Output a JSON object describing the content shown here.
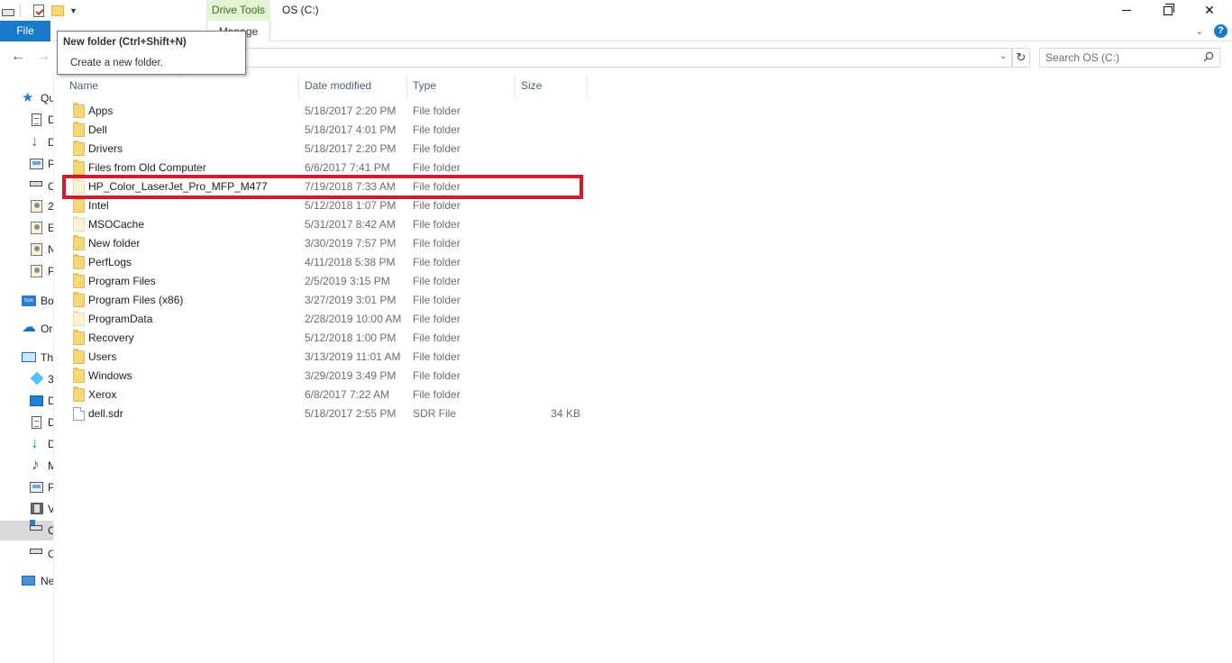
{
  "titlebar": {
    "context_tab_label": "Drive Tools",
    "window_title": "OS (C:)",
    "window_buttons": {
      "minimize": "minimize-icon",
      "maximize": "restore-icon",
      "close": "✕"
    }
  },
  "ribbon": {
    "file_tab": "File",
    "manage_tab": "Manage",
    "help_glyph": "?"
  },
  "nav": {
    "back_glyph": "←",
    "forward_glyph": "→",
    "dropdown_glyph": "⌄",
    "refresh_glyph": "↻"
  },
  "search": {
    "placeholder": "Search OS (C:)"
  },
  "tooltip": {
    "title": "New folder (Ctrl+Shift+N)",
    "description": "Create a new folder."
  },
  "sidebar": {
    "items": [
      {
        "label": "Qu",
        "icon": "star-icon"
      },
      {
        "label": "D",
        "icon": "document-icon"
      },
      {
        "label": "D",
        "icon": "download-icon"
      },
      {
        "label": "P",
        "icon": "pictures-icon"
      },
      {
        "label": "C",
        "icon": "drive-icon"
      },
      {
        "label": "2",
        "icon": "user-folder-icon"
      },
      {
        "label": "E",
        "icon": "user-folder-icon"
      },
      {
        "label": "N",
        "icon": "user-folder-icon"
      },
      {
        "label": "P",
        "icon": "user-folder-icon"
      },
      {
        "label": "Bo",
        "icon": "box-icon"
      },
      {
        "label": "Or",
        "icon": "cloud-icon"
      },
      {
        "label": "Th",
        "icon": "pc-icon"
      },
      {
        "label": "3",
        "icon": "3d-objects-icon"
      },
      {
        "label": "D",
        "icon": "desktop-icon"
      },
      {
        "label": "D",
        "icon": "document-icon"
      },
      {
        "label": "D",
        "icon": "download-icon"
      },
      {
        "label": "M",
        "icon": "music-icon"
      },
      {
        "label": "P",
        "icon": "pictures-icon"
      },
      {
        "label": "V",
        "icon": "video-icon"
      },
      {
        "label": "C",
        "icon": "os-drive-icon"
      },
      {
        "label": "C",
        "icon": "drive-icon"
      },
      {
        "label": "Ne",
        "icon": "network-icon"
      }
    ]
  },
  "filelist": {
    "columns": {
      "name": "Name",
      "date": "Date modified",
      "type": "Type",
      "size": "Size"
    },
    "sort_glyph": "^",
    "rows": [
      {
        "name": "Apps",
        "date": "5/18/2017 2:20 PM",
        "type": "File folder",
        "size": ""
      },
      {
        "name": "Dell",
        "date": "5/18/2017 4:01 PM",
        "type": "File folder",
        "size": ""
      },
      {
        "name": "Drivers",
        "date": "5/18/2017 2:20 PM",
        "type": "File folder",
        "size": ""
      },
      {
        "name": "Files from Old Computer",
        "date": "6/6/2017 7:41 PM",
        "type": "File folder",
        "size": ""
      },
      {
        "name": "HP_Color_LaserJet_Pro_MFP_M477",
        "date": "7/19/2018 7:33 AM",
        "type": "File folder",
        "size": ""
      },
      {
        "name": "Intel",
        "date": "5/12/2018 1:07 PM",
        "type": "File folder",
        "size": ""
      },
      {
        "name": "MSOCache",
        "date": "5/31/2017 8:42 AM",
        "type": "File folder",
        "size": ""
      },
      {
        "name": "New folder",
        "date": "3/30/2019 7:57 PM",
        "type": "File folder",
        "size": ""
      },
      {
        "name": "PerfLogs",
        "date": "4/11/2018 5:38 PM",
        "type": "File folder",
        "size": ""
      },
      {
        "name": "Program Files",
        "date": "2/5/2019 3:15 PM",
        "type": "File folder",
        "size": ""
      },
      {
        "name": "Program Files (x86)",
        "date": "3/27/2019 3:01 PM",
        "type": "File folder",
        "size": ""
      },
      {
        "name": "ProgramData",
        "date": "2/28/2019 10:00 AM",
        "type": "File folder",
        "size": ""
      },
      {
        "name": "Recovery",
        "date": "5/12/2018 1:00 PM",
        "type": "File folder",
        "size": ""
      },
      {
        "name": "Users",
        "date": "3/13/2019 11:01 AM",
        "type": "File folder",
        "size": ""
      },
      {
        "name": "Windows",
        "date": "3/29/2019 3:49 PM",
        "type": "File folder",
        "size": ""
      },
      {
        "name": "Xerox",
        "date": "6/8/2017 7:22 AM",
        "type": "File folder",
        "size": ""
      },
      {
        "name": "dell.sdr",
        "date": "5/18/2017 2:55 PM",
        "type": "SDR File",
        "size": "34 KB"
      }
    ]
  },
  "highlight": {
    "color": "#d11c2b",
    "target_row": "HP_Color_LaserJet_Pro_MFP_M477"
  },
  "colors": {
    "file_tab": "#1979ca",
    "context_tab": "#e2f4d5",
    "folder": "#f8d775"
  }
}
